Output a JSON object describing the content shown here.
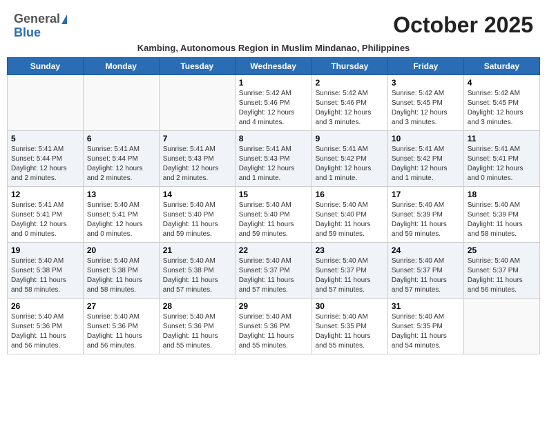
{
  "header": {
    "logo_general": "General",
    "logo_blue": "Blue",
    "month_title": "October 2025",
    "subtitle": "Kambing, Autonomous Region in Muslim Mindanao, Philippines"
  },
  "days_of_week": [
    "Sunday",
    "Monday",
    "Tuesday",
    "Wednesday",
    "Thursday",
    "Friday",
    "Saturday"
  ],
  "weeks": [
    [
      {
        "day": "",
        "text": "",
        "empty": true
      },
      {
        "day": "",
        "text": "",
        "empty": true
      },
      {
        "day": "",
        "text": "",
        "empty": true
      },
      {
        "day": "1",
        "text": "Sunrise: 5:42 AM\nSunset: 5:46 PM\nDaylight: 12 hours\nand 4 minutes.",
        "empty": false
      },
      {
        "day": "2",
        "text": "Sunrise: 5:42 AM\nSunset: 5:46 PM\nDaylight: 12 hours\nand 3 minutes.",
        "empty": false
      },
      {
        "day": "3",
        "text": "Sunrise: 5:42 AM\nSunset: 5:45 PM\nDaylight: 12 hours\nand 3 minutes.",
        "empty": false
      },
      {
        "day": "4",
        "text": "Sunrise: 5:42 AM\nSunset: 5:45 PM\nDaylight: 12 hours\nand 3 minutes.",
        "empty": false
      }
    ],
    [
      {
        "day": "5",
        "text": "Sunrise: 5:41 AM\nSunset: 5:44 PM\nDaylight: 12 hours\nand 2 minutes.",
        "empty": false,
        "shaded": true
      },
      {
        "day": "6",
        "text": "Sunrise: 5:41 AM\nSunset: 5:44 PM\nDaylight: 12 hours\nand 2 minutes.",
        "empty": false,
        "shaded": true
      },
      {
        "day": "7",
        "text": "Sunrise: 5:41 AM\nSunset: 5:43 PM\nDaylight: 12 hours\nand 2 minutes.",
        "empty": false,
        "shaded": true
      },
      {
        "day": "8",
        "text": "Sunrise: 5:41 AM\nSunset: 5:43 PM\nDaylight: 12 hours\nand 1 minute.",
        "empty": false,
        "shaded": true
      },
      {
        "day": "9",
        "text": "Sunrise: 5:41 AM\nSunset: 5:42 PM\nDaylight: 12 hours\nand 1 minute.",
        "empty": false,
        "shaded": true
      },
      {
        "day": "10",
        "text": "Sunrise: 5:41 AM\nSunset: 5:42 PM\nDaylight: 12 hours\nand 1 minute.",
        "empty": false,
        "shaded": true
      },
      {
        "day": "11",
        "text": "Sunrise: 5:41 AM\nSunset: 5:41 PM\nDaylight: 12 hours\nand 0 minutes.",
        "empty": false,
        "shaded": true
      }
    ],
    [
      {
        "day": "12",
        "text": "Sunrise: 5:41 AM\nSunset: 5:41 PM\nDaylight: 12 hours\nand 0 minutes.",
        "empty": false
      },
      {
        "day": "13",
        "text": "Sunrise: 5:40 AM\nSunset: 5:41 PM\nDaylight: 12 hours\nand 0 minutes.",
        "empty": false
      },
      {
        "day": "14",
        "text": "Sunrise: 5:40 AM\nSunset: 5:40 PM\nDaylight: 11 hours\nand 59 minutes.",
        "empty": false
      },
      {
        "day": "15",
        "text": "Sunrise: 5:40 AM\nSunset: 5:40 PM\nDaylight: 11 hours\nand 59 minutes.",
        "empty": false
      },
      {
        "day": "16",
        "text": "Sunrise: 5:40 AM\nSunset: 5:40 PM\nDaylight: 11 hours\nand 59 minutes.",
        "empty": false
      },
      {
        "day": "17",
        "text": "Sunrise: 5:40 AM\nSunset: 5:39 PM\nDaylight: 11 hours\nand 59 minutes.",
        "empty": false
      },
      {
        "day": "18",
        "text": "Sunrise: 5:40 AM\nSunset: 5:39 PM\nDaylight: 11 hours\nand 58 minutes.",
        "empty": false
      }
    ],
    [
      {
        "day": "19",
        "text": "Sunrise: 5:40 AM\nSunset: 5:38 PM\nDaylight: 11 hours\nand 58 minutes.",
        "empty": false,
        "shaded": true
      },
      {
        "day": "20",
        "text": "Sunrise: 5:40 AM\nSunset: 5:38 PM\nDaylight: 11 hours\nand 58 minutes.",
        "empty": false,
        "shaded": true
      },
      {
        "day": "21",
        "text": "Sunrise: 5:40 AM\nSunset: 5:38 PM\nDaylight: 11 hours\nand 57 minutes.",
        "empty": false,
        "shaded": true
      },
      {
        "day": "22",
        "text": "Sunrise: 5:40 AM\nSunset: 5:37 PM\nDaylight: 11 hours\nand 57 minutes.",
        "empty": false,
        "shaded": true
      },
      {
        "day": "23",
        "text": "Sunrise: 5:40 AM\nSunset: 5:37 PM\nDaylight: 11 hours\nand 57 minutes.",
        "empty": false,
        "shaded": true
      },
      {
        "day": "24",
        "text": "Sunrise: 5:40 AM\nSunset: 5:37 PM\nDaylight: 11 hours\nand 57 minutes.",
        "empty": false,
        "shaded": true
      },
      {
        "day": "25",
        "text": "Sunrise: 5:40 AM\nSunset: 5:37 PM\nDaylight: 11 hours\nand 56 minutes.",
        "empty": false,
        "shaded": true
      }
    ],
    [
      {
        "day": "26",
        "text": "Sunrise: 5:40 AM\nSunset: 5:36 PM\nDaylight: 11 hours\nand 56 minutes.",
        "empty": false
      },
      {
        "day": "27",
        "text": "Sunrise: 5:40 AM\nSunset: 5:36 PM\nDaylight: 11 hours\nand 56 minutes.",
        "empty": false
      },
      {
        "day": "28",
        "text": "Sunrise: 5:40 AM\nSunset: 5:36 PM\nDaylight: 11 hours\nand 55 minutes.",
        "empty": false
      },
      {
        "day": "29",
        "text": "Sunrise: 5:40 AM\nSunset: 5:36 PM\nDaylight: 11 hours\nand 55 minutes.",
        "empty": false
      },
      {
        "day": "30",
        "text": "Sunrise: 5:40 AM\nSunset: 5:35 PM\nDaylight: 11 hours\nand 55 minutes.",
        "empty": false
      },
      {
        "day": "31",
        "text": "Sunrise: 5:40 AM\nSunset: 5:35 PM\nDaylight: 11 hours\nand 54 minutes.",
        "empty": false
      },
      {
        "day": "",
        "text": "",
        "empty": true
      }
    ]
  ]
}
